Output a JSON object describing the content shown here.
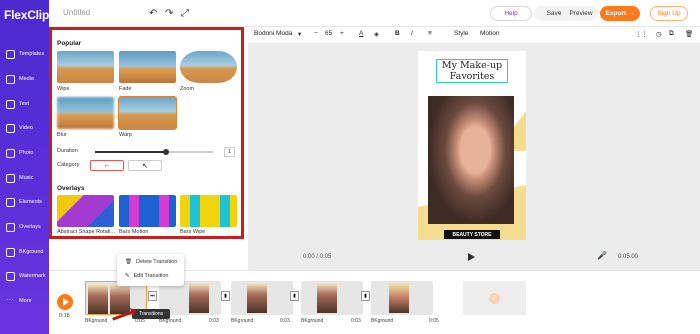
{
  "app": {
    "logo": "FlexClip",
    "title": "Untitled"
  },
  "sidebar": {
    "items": [
      {
        "label": "Templates"
      },
      {
        "label": "Media"
      },
      {
        "label": "Text"
      },
      {
        "label": "Video"
      },
      {
        "label": "Photo"
      },
      {
        "label": "Music"
      },
      {
        "label": "Elements"
      },
      {
        "label": "Overlays"
      },
      {
        "label": "BKground"
      },
      {
        "label": "Watermark"
      },
      {
        "label": "More"
      }
    ]
  },
  "topbar": {
    "help": "Help",
    "save": "Save",
    "preview": "Preview",
    "export": "Export →",
    "signup": "Sign Up"
  },
  "format_toolbar": {
    "font": "Bodoni Moda",
    "font_size": "65",
    "bold": "B",
    "italic": "I",
    "style": "Style",
    "motion": "Motion"
  },
  "panel": {
    "popular_title": "Popular",
    "popular": [
      {
        "label": "Wipe"
      },
      {
        "label": "Fade"
      },
      {
        "label": "Zoom"
      },
      {
        "label": "Blur"
      },
      {
        "label": "Warp"
      }
    ],
    "duration_label": "Duration",
    "duration_value": "1",
    "duration_level": 0.6,
    "category_label": "Category",
    "category_options": [
      "←",
      "↖"
    ],
    "overlays_title": "Overlays",
    "overlays": [
      {
        "label": "Abstract Shape Rotati..."
      },
      {
        "label": "Bars Motion"
      },
      {
        "label": "Bars Wipe"
      }
    ]
  },
  "canvas": {
    "design_title": "My Make-up Favorites",
    "store_label": "BEAUTY STORE",
    "time_current": "0:00 / 0:05",
    "time_end": "0:05.00"
  },
  "timeline": {
    "current_time": "0:18",
    "clips": [
      {
        "label": "BKground",
        "duration": "0:05"
      },
      {
        "label": "BKground",
        "duration": "0:03"
      },
      {
        "label": "BKground",
        "duration": "0:03"
      },
      {
        "label": "BKground",
        "duration": "0:03"
      },
      {
        "label": "BKground",
        "duration": "0:05"
      }
    ],
    "add_label": "+"
  },
  "context_menu": {
    "delete": "Delete Transition",
    "edit": "Edit Transition",
    "tooltip": "Transitions"
  },
  "colors": {
    "sidebar": "#5b2fd9",
    "accent": "#ff7a1a",
    "highlight_border": "#c3211d"
  }
}
